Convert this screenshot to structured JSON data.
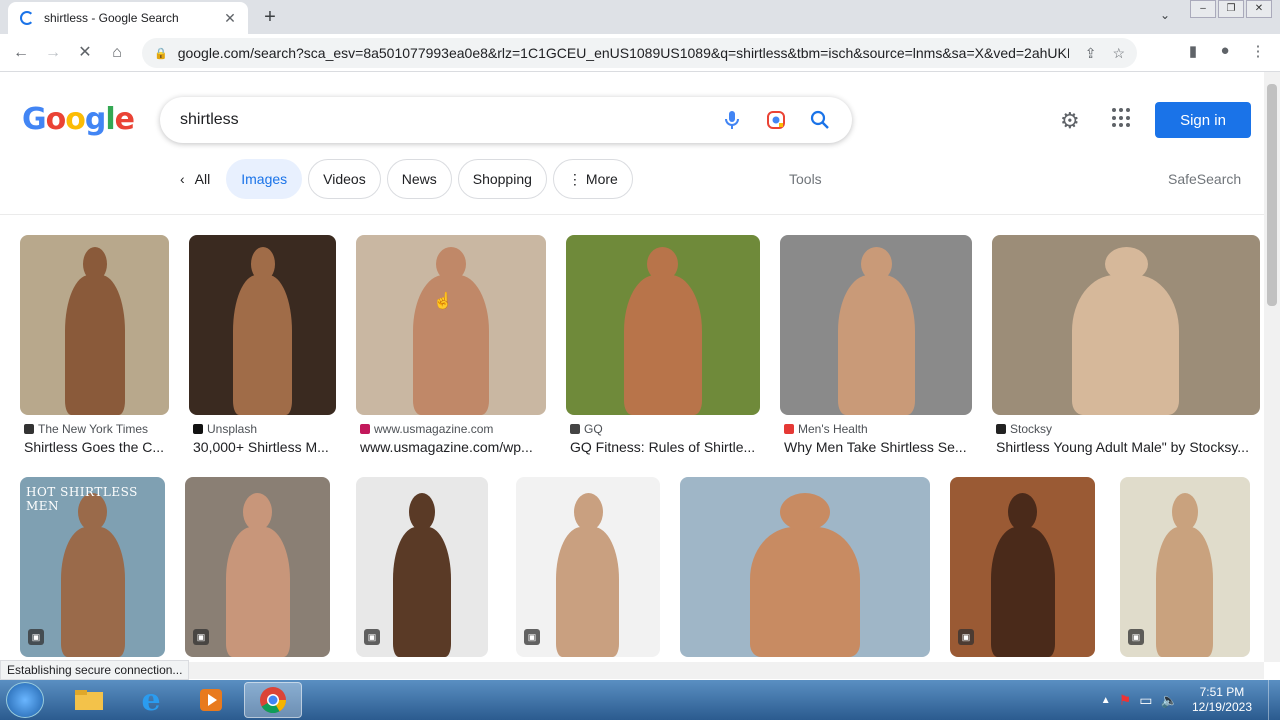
{
  "browser": {
    "tab_title": "shirtless - Google Search",
    "url": "google.com/search?sca_esv=8a501077993ea0e8&rlz=1C1GCEU_enUS1089US1089&q=shirtless&tbm=isch&source=lnms&sa=X&ved=2ahUKEwj-i7...",
    "status_text": "Establishing secure connection..."
  },
  "search": {
    "query": "shirtless",
    "signin_label": "Sign in",
    "logo_letters": [
      "G",
      "o",
      "o",
      "g",
      "l",
      "e"
    ]
  },
  "filters": {
    "all_label": "All",
    "chips": [
      "Images",
      "Videos",
      "News",
      "Shopping"
    ],
    "more_label": "More",
    "tools_label": "Tools",
    "safesearch_label": "SafeSearch"
  },
  "results_row1": [
    {
      "source": "The New York Times",
      "caption": "Shirtless Goes the C...",
      "bg": "#b8a88c",
      "skin": "#8a5a3a",
      "favicon": "#333333"
    },
    {
      "source": "Unsplash",
      "caption": "30,000+ Shirtless M...",
      "bg": "#3a2a20",
      "skin": "#a06c48",
      "favicon": "#111111"
    },
    {
      "source": "www.usmagazine.com",
      "caption": "www.usmagazine.com/wp...",
      "bg": "#c9b7a2",
      "skin": "#c08868",
      "favicon": "#c2185b"
    },
    {
      "source": "GQ",
      "caption": "GQ Fitness: Rules of Shirtle...",
      "bg": "#6f8a3a",
      "skin": "#b8744a",
      "favicon": "#444444"
    },
    {
      "source": "Men's Health",
      "caption": "Why Men Take Shirtless Se...",
      "bg": "#8a8a8a",
      "skin": "#c99a78",
      "favicon": "#e53935"
    },
    {
      "source": "Stocksy",
      "caption": "Shirtless Young Adult Male\" by Stocksy...",
      "bg": "#9c8d78",
      "skin": "#d6b89a",
      "favicon": "#222222"
    }
  ],
  "results_row2": [
    {
      "bg": "#7fa0b2",
      "skin": "#9a6a4a",
      "overlay": "HOT SHIRTLESS MEN"
    },
    {
      "bg": "#8a7f74",
      "skin": "#c8967a"
    },
    {
      "bg": "#e8e8e8",
      "skin": "#5a3a26"
    },
    {
      "bg": "#f2f2f2",
      "skin": "#c9a080"
    },
    {
      "bg": "#9fb6c7",
      "skin": "#c88b62"
    },
    {
      "bg": "#9a5a34",
      "skin": "#4a2a1a"
    },
    {
      "bg": "#e0dccb",
      "skin": "#c9a27e"
    }
  ],
  "taskbar": {
    "time": "7:51 PM",
    "date": "12/19/2023"
  }
}
